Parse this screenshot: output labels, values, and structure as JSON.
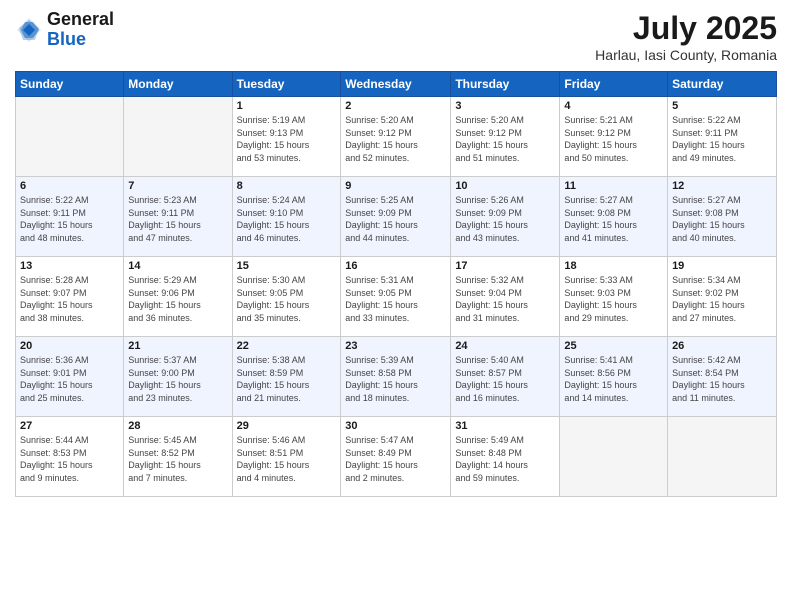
{
  "logo": {
    "general": "General",
    "blue": "Blue"
  },
  "title": {
    "month_year": "July 2025",
    "location": "Harlau, Iasi County, Romania"
  },
  "weekdays": [
    "Sunday",
    "Monday",
    "Tuesday",
    "Wednesday",
    "Thursday",
    "Friday",
    "Saturday"
  ],
  "weeks": [
    [
      {
        "day": "",
        "info": ""
      },
      {
        "day": "",
        "info": ""
      },
      {
        "day": "1",
        "info": "Sunrise: 5:19 AM\nSunset: 9:13 PM\nDaylight: 15 hours\nand 53 minutes."
      },
      {
        "day": "2",
        "info": "Sunrise: 5:20 AM\nSunset: 9:12 PM\nDaylight: 15 hours\nand 52 minutes."
      },
      {
        "day": "3",
        "info": "Sunrise: 5:20 AM\nSunset: 9:12 PM\nDaylight: 15 hours\nand 51 minutes."
      },
      {
        "day": "4",
        "info": "Sunrise: 5:21 AM\nSunset: 9:12 PM\nDaylight: 15 hours\nand 50 minutes."
      },
      {
        "day": "5",
        "info": "Sunrise: 5:22 AM\nSunset: 9:11 PM\nDaylight: 15 hours\nand 49 minutes."
      }
    ],
    [
      {
        "day": "6",
        "info": "Sunrise: 5:22 AM\nSunset: 9:11 PM\nDaylight: 15 hours\nand 48 minutes."
      },
      {
        "day": "7",
        "info": "Sunrise: 5:23 AM\nSunset: 9:11 PM\nDaylight: 15 hours\nand 47 minutes."
      },
      {
        "day": "8",
        "info": "Sunrise: 5:24 AM\nSunset: 9:10 PM\nDaylight: 15 hours\nand 46 minutes."
      },
      {
        "day": "9",
        "info": "Sunrise: 5:25 AM\nSunset: 9:09 PM\nDaylight: 15 hours\nand 44 minutes."
      },
      {
        "day": "10",
        "info": "Sunrise: 5:26 AM\nSunset: 9:09 PM\nDaylight: 15 hours\nand 43 minutes."
      },
      {
        "day": "11",
        "info": "Sunrise: 5:27 AM\nSunset: 9:08 PM\nDaylight: 15 hours\nand 41 minutes."
      },
      {
        "day": "12",
        "info": "Sunrise: 5:27 AM\nSunset: 9:08 PM\nDaylight: 15 hours\nand 40 minutes."
      }
    ],
    [
      {
        "day": "13",
        "info": "Sunrise: 5:28 AM\nSunset: 9:07 PM\nDaylight: 15 hours\nand 38 minutes."
      },
      {
        "day": "14",
        "info": "Sunrise: 5:29 AM\nSunset: 9:06 PM\nDaylight: 15 hours\nand 36 minutes."
      },
      {
        "day": "15",
        "info": "Sunrise: 5:30 AM\nSunset: 9:05 PM\nDaylight: 15 hours\nand 35 minutes."
      },
      {
        "day": "16",
        "info": "Sunrise: 5:31 AM\nSunset: 9:05 PM\nDaylight: 15 hours\nand 33 minutes."
      },
      {
        "day": "17",
        "info": "Sunrise: 5:32 AM\nSunset: 9:04 PM\nDaylight: 15 hours\nand 31 minutes."
      },
      {
        "day": "18",
        "info": "Sunrise: 5:33 AM\nSunset: 9:03 PM\nDaylight: 15 hours\nand 29 minutes."
      },
      {
        "day": "19",
        "info": "Sunrise: 5:34 AM\nSunset: 9:02 PM\nDaylight: 15 hours\nand 27 minutes."
      }
    ],
    [
      {
        "day": "20",
        "info": "Sunrise: 5:36 AM\nSunset: 9:01 PM\nDaylight: 15 hours\nand 25 minutes."
      },
      {
        "day": "21",
        "info": "Sunrise: 5:37 AM\nSunset: 9:00 PM\nDaylight: 15 hours\nand 23 minutes."
      },
      {
        "day": "22",
        "info": "Sunrise: 5:38 AM\nSunset: 8:59 PM\nDaylight: 15 hours\nand 21 minutes."
      },
      {
        "day": "23",
        "info": "Sunrise: 5:39 AM\nSunset: 8:58 PM\nDaylight: 15 hours\nand 18 minutes."
      },
      {
        "day": "24",
        "info": "Sunrise: 5:40 AM\nSunset: 8:57 PM\nDaylight: 15 hours\nand 16 minutes."
      },
      {
        "day": "25",
        "info": "Sunrise: 5:41 AM\nSunset: 8:56 PM\nDaylight: 15 hours\nand 14 minutes."
      },
      {
        "day": "26",
        "info": "Sunrise: 5:42 AM\nSunset: 8:54 PM\nDaylight: 15 hours\nand 11 minutes."
      }
    ],
    [
      {
        "day": "27",
        "info": "Sunrise: 5:44 AM\nSunset: 8:53 PM\nDaylight: 15 hours\nand 9 minutes."
      },
      {
        "day": "28",
        "info": "Sunrise: 5:45 AM\nSunset: 8:52 PM\nDaylight: 15 hours\nand 7 minutes."
      },
      {
        "day": "29",
        "info": "Sunrise: 5:46 AM\nSunset: 8:51 PM\nDaylight: 15 hours\nand 4 minutes."
      },
      {
        "day": "30",
        "info": "Sunrise: 5:47 AM\nSunset: 8:49 PM\nDaylight: 15 hours\nand 2 minutes."
      },
      {
        "day": "31",
        "info": "Sunrise: 5:49 AM\nSunset: 8:48 PM\nDaylight: 14 hours\nand 59 minutes."
      },
      {
        "day": "",
        "info": ""
      },
      {
        "day": "",
        "info": ""
      }
    ]
  ]
}
